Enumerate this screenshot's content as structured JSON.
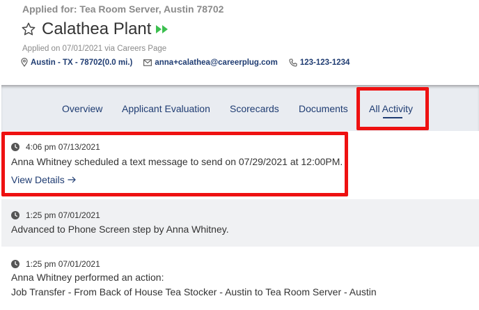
{
  "header": {
    "applied_for": "Applied for: Tea Room Server, Austin 78702",
    "candidate_name": "Calathea Plant",
    "applied_on": "Applied on 07/01/2021 via Careers Page",
    "location": "Austin - TX - 78702(0.0 mi.)",
    "email": "anna+calathea@careerplug.com",
    "phone": "123-123-1234",
    "icons": [
      "star-outline-icon",
      "fast-forward-icon",
      "map-pin-icon",
      "envelope-icon",
      "phone-icon"
    ],
    "colors": {
      "accent": "#1f3c72",
      "fast_forward": "#3cbf4f",
      "highlight": "#ee1111"
    }
  },
  "tabs": {
    "items": [
      "Overview",
      "Applicant Evaluation",
      "Scorecards",
      "Documents",
      "All Activity"
    ],
    "active": "All Activity"
  },
  "activities": [
    {
      "time": "4:06 pm 07/13/2021",
      "lines": [
        "Anna Whitney scheduled a text message to send on 07/29/2021 at 12:00PM."
      ],
      "link": "View Details"
    },
    {
      "time": "1:25 pm 07/01/2021",
      "lines": [
        "Advanced to Phone Screen step by Anna Whitney."
      ]
    },
    {
      "time": "1:25 pm 07/01/2021",
      "lines": [
        "Anna Whitney performed an action:",
        "Job Transfer - From Back of House Tea Stocker - Austin to Tea Room Server - Austin"
      ]
    }
  ]
}
